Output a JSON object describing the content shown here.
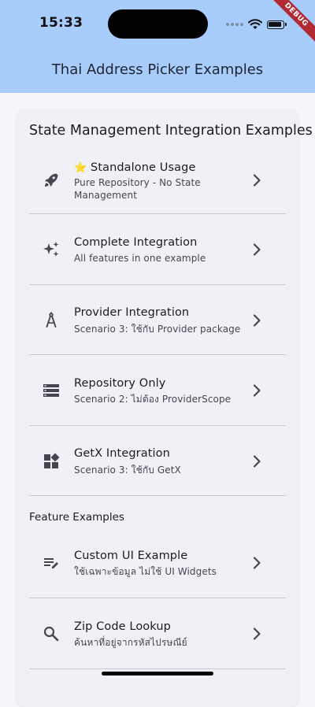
{
  "status_bar": {
    "time": "15:33"
  },
  "debug_label": "DEBUG",
  "app_bar": {
    "title": "Thai Address Picker Examples"
  },
  "card": {
    "title": "State Management Integration Examples",
    "items": [
      {
        "emoji": "⭐",
        "title": "Standalone Usage",
        "subtitle": "Pure Repository - No State Management",
        "icon": "rocket-icon"
      },
      {
        "title": "Complete Integration",
        "subtitle": "All features in one example",
        "icon": "sparkle-icon"
      },
      {
        "title": "Provider Integration",
        "subtitle": "Scenario 3: ใช้กับ Provider package",
        "icon": "compass-icon"
      },
      {
        "title": "Repository Only",
        "subtitle": "Scenario 2: ไม่ต้อง ProviderScope",
        "icon": "storage-icon"
      },
      {
        "title": "GetX Integration",
        "subtitle": "Scenario 3: ใช้กับ GetX",
        "icon": "widgets-icon"
      }
    ]
  },
  "feature_section": {
    "title": "Feature Examples",
    "items": [
      {
        "title": "Custom UI Example",
        "subtitle": "ใช้เฉพาะข้อมูล ไม่ใช้ UI Widgets",
        "icon": "edit-note-icon"
      },
      {
        "title": "Zip Code Lookup",
        "subtitle": "ค้นหาที่อยู่จากรหัสไปรษณีย์",
        "icon": "search-icon"
      }
    ]
  }
}
